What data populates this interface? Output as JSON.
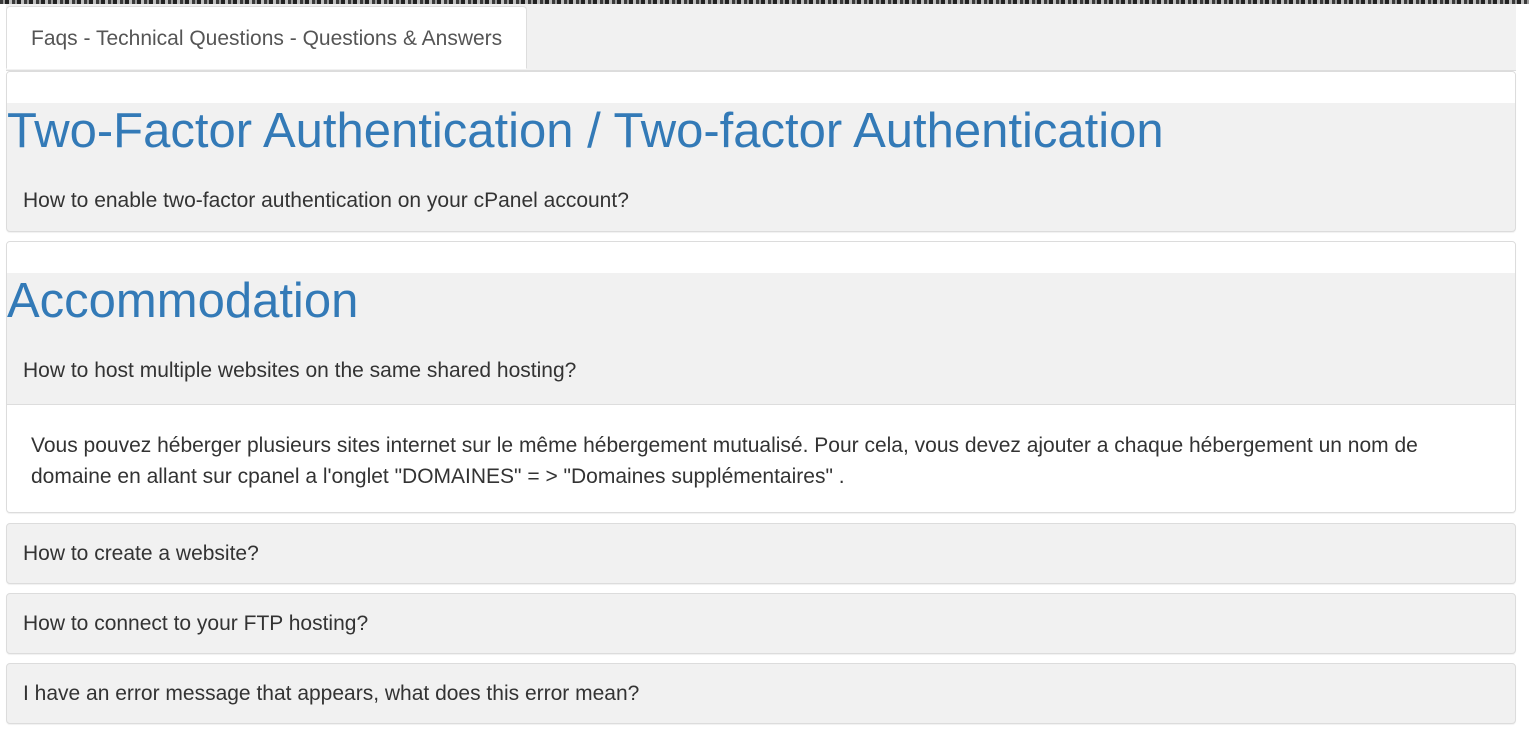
{
  "tab": {
    "label": "Faqs - Technical Questions - Questions & Answers"
  },
  "sections": [
    {
      "title": "Two-Factor Authentication / Two-factor Authentication",
      "questions": [
        {
          "label": "How to enable two-factor authentication on your cPanel account?"
        }
      ]
    },
    {
      "title": "Accommodation",
      "questions": [
        {
          "label": "How to host multiple websites on the same shared hosting?",
          "answer": "Vous pouvez héberger plusieurs sites internet sur le même hébergement mutualisé. Pour cela, vous devez ajouter a chaque hébergement un nom de domaine en allant sur cpanel a l'onglet \"DOMAINES\" = > \"Domaines supplémentaires\" ."
        }
      ]
    }
  ],
  "more_questions": [
    {
      "label": "How to create a website?"
    },
    {
      "label": "How to connect to your FTP hosting?"
    },
    {
      "label": "I have an error message that appears, what does this error mean?"
    }
  ],
  "colors": {
    "title_accent": "#337ab7",
    "panel_background": "#f1f1f1",
    "text": "#333333"
  }
}
